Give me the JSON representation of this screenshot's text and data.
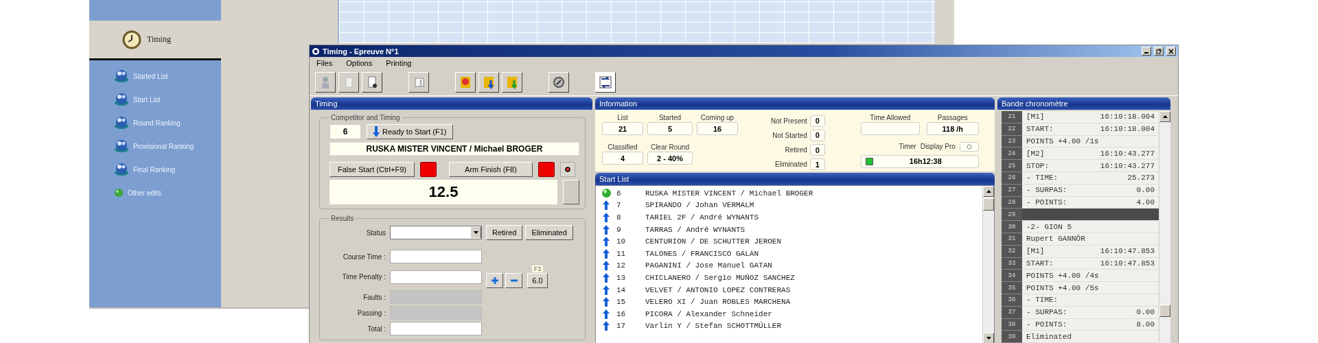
{
  "back_window": {
    "sidebar": {
      "section": "Timing",
      "items": [
        {
          "label": "Started List",
          "kind": "list"
        },
        {
          "label": "Start List",
          "kind": "list"
        },
        {
          "label": "Round Ranking",
          "kind": "list"
        },
        {
          "label": "Provisional Ranking",
          "kind": "list"
        },
        {
          "label": "Final Ranking",
          "kind": "list"
        },
        {
          "label": "Other edits",
          "kind": "action"
        }
      ]
    }
  },
  "window": {
    "title": "Timing - Epreuve N°1",
    "menu": [
      "Files",
      "Options",
      "Printing"
    ]
  },
  "timing_panel": {
    "title": "Timing",
    "competitor_group": {
      "title": "Competitor and Timing",
      "number": "6",
      "ready_button": "Ready to Start (F1)",
      "competitor": "RUSKA MISTER VINCENT / Michael BROGER",
      "false_start_button": "False Start (Ctrl+F9)",
      "arm_finish_button": "Arm Finish (F8)",
      "time": "12.5"
    },
    "results_group": {
      "title": "Results",
      "status_label": "Status",
      "retired_button": "Retired",
      "eliminated_button": "Eliminated",
      "penalty_hint": "F3",
      "penalty_button": "6.0",
      "fields": [
        {
          "label": "Course Time :",
          "disabled": false
        },
        {
          "label": "Time Penalty :",
          "disabled": false
        },
        {
          "label": "Faults :",
          "disabled": true
        },
        {
          "label": "Passing :",
          "disabled": true
        },
        {
          "label": "Total :",
          "disabled": false
        }
      ]
    }
  },
  "information": {
    "title": "Information",
    "counters": [
      {
        "label": "List",
        "value": "21"
      },
      {
        "label": "Started",
        "value": "5"
      },
      {
        "label": "Coming up",
        "value": "16"
      },
      {
        "label": "Classified",
        "value": "4"
      },
      {
        "label": "Clear Round",
        "value": "2 - 40%"
      }
    ],
    "status_counts": [
      {
        "label": "Not Present",
        "value": "0"
      },
      {
        "label": "Not Started",
        "value": "0"
      },
      {
        "label": "Retired",
        "value": "0"
      },
      {
        "label": "Eliminated",
        "value": "1"
      }
    ],
    "time_allowed_label": "Time Allowed",
    "passages_label": "Passages",
    "passages": "118 /h",
    "timer_label": "Timer",
    "display_label": "Display Pro",
    "display_on": false,
    "timer": {
      "value": "16h12:38",
      "running": true
    }
  },
  "start_list": {
    "title": "Start List",
    "rows": [
      {
        "number": "6",
        "name": "RUSKA MISTER VINCENT / Michael BROGER",
        "current": true
      },
      {
        "number": "7",
        "name": "SPIRANDO / Johan VERMALM",
        "current": false
      },
      {
        "number": "8",
        "name": "TARIEL 2F / André WYNANTS",
        "current": false
      },
      {
        "number": "9",
        "name": "TARRAS / André WYNANTS",
        "current": false
      },
      {
        "number": "10",
        "name": "CENTURION / DE SCHUTTER JEROEN",
        "current": false
      },
      {
        "number": "11",
        "name": "TALONES / FRANCISCO GALAN",
        "current": false
      },
      {
        "number": "12",
        "name": "PAGANINI / Jose Manuel GATAN",
        "current": false
      },
      {
        "number": "13",
        "name": "CHICLANERO / Sergio MUÑOZ SANCHEZ",
        "current": false
      },
      {
        "number": "14",
        "name": "VELVET / ANTONIO LOPEZ CONTRERAS",
        "current": false
      },
      {
        "number": "15",
        "name": "VELERO XI / Juan ROBLES MARCHENA",
        "current": false
      },
      {
        "number": "16",
        "name": "PICORA / Alexander Schneider",
        "current": false
      },
      {
        "number": "17",
        "name": "Varlin Y / Stefan SCHOTTMÜLLER",
        "current": false
      }
    ]
  },
  "chronometer": {
    "title": "Bande chronomètre",
    "lines": [
      {
        "number": "21",
        "text": "[M1]",
        "value": "16:10:18.004",
        "kind": "entry"
      },
      {
        "number": "22",
        "text": "START:",
        "value": "16:10:18.004",
        "kind": "entry"
      },
      {
        "number": "23",
        "text": "POINTS +4.00 /1s",
        "kind": "entry"
      },
      {
        "number": "24",
        "text": "[M2]",
        "value": "16:10:43.277",
        "kind": "entry"
      },
      {
        "number": "25",
        "text": "STOP:",
        "value": "16:10:43.277",
        "kind": "entry"
      },
      {
        "number": "26",
        "text": "- TIME:",
        "value": "25.273",
        "kind": "entry"
      },
      {
        "number": "27",
        "text": "- SURPAS:",
        "value": "0.00",
        "kind": "entry"
      },
      {
        "number": "28",
        "text": "- POINTS:",
        "value": "4.00",
        "kind": "entry"
      },
      {
        "number": "29",
        "kind": "separator"
      },
      {
        "number": "30",
        "text": "-2- GION 5",
        "kind": "entry"
      },
      {
        "number": "31",
        "text": "Rupert GANNÖR",
        "kind": "entry"
      },
      {
        "number": "32",
        "text": "[M1]",
        "value": "16:10:47.853",
        "kind": "entry"
      },
      {
        "number": "33",
        "text": "START:",
        "value": "16:10:47.853",
        "kind": "entry"
      },
      {
        "number": "34",
        "text": "POINTS +4.00 /4s",
        "kind": "entry"
      },
      {
        "number": "35",
        "text": "POINTS +4.00 /5s",
        "kind": "entry"
      },
      {
        "number": "36",
        "text": "- TIME:",
        "kind": "entry"
      },
      {
        "number": "37",
        "text": "- SURPAS:",
        "value": "0.00",
        "kind": "entry"
      },
      {
        "number": "38",
        "text": "- POINTS:",
        "value": "8.00",
        "kind": "entry"
      },
      {
        "number": "39",
        "text": "Eliminated",
        "kind": "entry"
      }
    ]
  }
}
